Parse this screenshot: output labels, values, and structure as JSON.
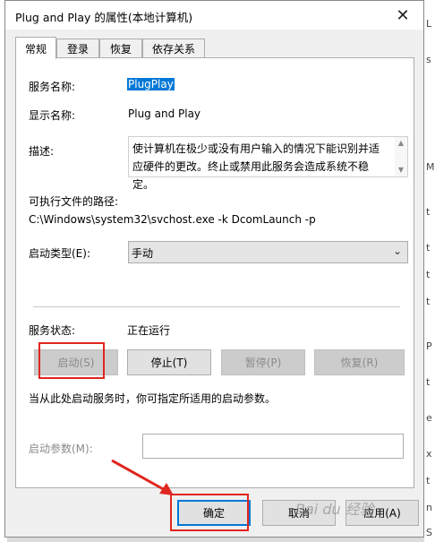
{
  "window": {
    "title": "Plug and Play 的属性(本地计算机)",
    "close_glyph": "✕"
  },
  "tabs": [
    {
      "label": "常规",
      "active": true
    },
    {
      "label": "登录",
      "active": false
    },
    {
      "label": "恢复",
      "active": false
    },
    {
      "label": "依存关系",
      "active": false
    }
  ],
  "general": {
    "service_name_label": "服务名称:",
    "service_name_value": "PlugPlay",
    "display_name_label": "显示名称:",
    "display_name_value": "Plug and Play",
    "description_label": "描述:",
    "description_value": "使计算机在极少或没有用户输入的情况下能识别并适应硬件的更改。终止或禁用此服务会造成系统不稳定。",
    "path_label": "可执行文件的路径:",
    "path_value": "C:\\Windows\\system32\\svchost.exe -k DcomLaunch -p",
    "startup_type_label": "启动类型(E):",
    "startup_type_value": "手动",
    "status_label": "服务状态:",
    "status_value": "正在运行",
    "hint": "当从此处启动服务时，你可指定所适用的启动参数。",
    "params_label": "启动参数(M):",
    "params_value": ""
  },
  "service_buttons": {
    "start": {
      "label": "启动(S)",
      "enabled": false
    },
    "stop": {
      "label": "停止(T)",
      "enabled": true
    },
    "pause": {
      "label": "暂停(P)",
      "enabled": false
    },
    "resume": {
      "label": "恢复(R)",
      "enabled": false
    }
  },
  "footer": {
    "ok": "确定",
    "cancel": "取消",
    "apply": "应用(A)"
  },
  "background": {
    "right_edge_chars": [
      "L",
      "s",
      "M",
      "t",
      "t",
      "t",
      "t",
      "P",
      "t",
      "e",
      "x",
      "t",
      "n",
      "S"
    ]
  },
  "colors": {
    "selection": "#0078d7",
    "annotation_red": "#e0261f"
  }
}
